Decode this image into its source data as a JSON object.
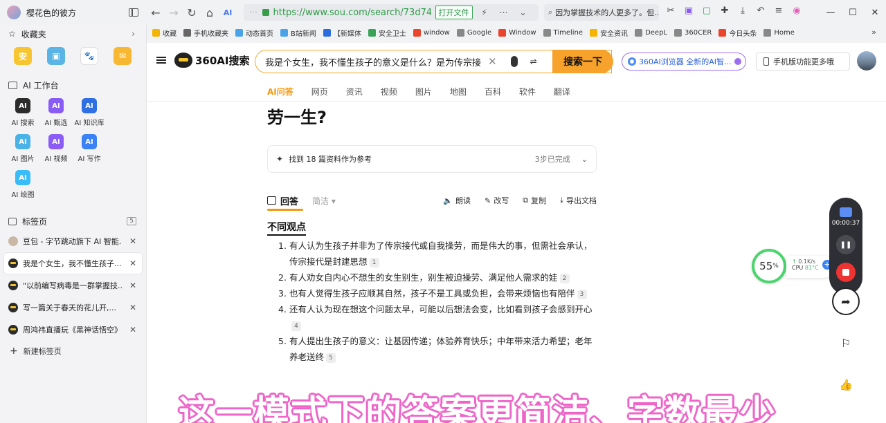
{
  "window": {
    "title": "樱花色的彼方"
  },
  "address_bar": {
    "url": "https://www.sou.com/search/73d74693c",
    "open_file_label": "打开文件"
  },
  "browser_search": {
    "query": "因为掌握技术的人更多了。但..."
  },
  "sidebar": {
    "favorites_label": "收藏夹",
    "fav_apps": [
      {
        "icon": "安",
        "color": "#f6c531"
      },
      {
        "icon": "bili-tv-icon",
        "color": "#5ab4e6"
      },
      {
        "icon": "paw-icon",
        "color": "#ffffff"
      },
      {
        "icon": "mail-icon",
        "color": "#f8b733"
      }
    ],
    "ai_workbench_label": "AI 工作台",
    "ai_tools": [
      {
        "label": "AI 搜索",
        "color": "#2b2b2b"
      },
      {
        "label": "AI 甄选",
        "color": "#8a5cf6"
      },
      {
        "label": "AI 知识库",
        "color": "#2f6fe4"
      },
      {
        "label": "AI 图片",
        "color": "#49b3e8"
      },
      {
        "label": "AI 视频",
        "color": "#8b5cf6"
      },
      {
        "label": "AI 写作",
        "color": "#3b82f6"
      },
      {
        "label": "AI 绘图",
        "color": "#38bdf8"
      }
    ],
    "tabs_label": "标签页",
    "tabs_count": "5",
    "tabs": [
      {
        "title": "豆包 - 字节跳动旗下 AI 智能..."
      },
      {
        "title": "我是个女生，我不懂生孩子..."
      },
      {
        "title": "\"以前编写病毒是一群掌握技..."
      },
      {
        "title": "写一篇关于春天的花儿开,..."
      },
      {
        "title": "周鸿祎直播玩《黑神话悟空》..."
      }
    ],
    "new_tab_label": "新建标签页"
  },
  "bookmarks": [
    {
      "label": "收藏",
      "color": "#f4b400"
    },
    {
      "label": "手机收藏夹",
      "color": "#666666"
    },
    {
      "label": "动态首页",
      "color": "#4aa3e8"
    },
    {
      "label": "B站新闻",
      "color": "#4aa3e8"
    },
    {
      "label": "【新媒体",
      "color": "#2b6de0"
    },
    {
      "label": "安全卫士",
      "color": "#3aa35a"
    },
    {
      "label": "window",
      "color": "#e8452c"
    },
    {
      "label": "Google",
      "color": "#888888"
    },
    {
      "label": "Window",
      "color": "#e8452c"
    },
    {
      "label": "Timeline",
      "color": "#888888"
    },
    {
      "label": "安全资讯",
      "color": "#f4b400"
    },
    {
      "label": "DeepL",
      "color": "#888888"
    },
    {
      "label": "360CER",
      "color": "#888888"
    },
    {
      "label": "今日头条",
      "color": "#e8452c"
    },
    {
      "label": "Home",
      "color": "#888888"
    }
  ],
  "page": {
    "logo_text": "360AI搜索",
    "query": "我是个女生，我不懂生孩子的意义是什么？是为传宗接代，还",
    "search_button": "搜索一下",
    "promo": "360AI浏览器 全新的AI智...",
    "mobile_link": "手机版功能更多哦",
    "categories": [
      "AI问答",
      "网页",
      "资讯",
      "视频",
      "图片",
      "地图",
      "百科",
      "软件",
      "翻译"
    ],
    "title_fragment": "劳一生?",
    "ref_text": "找到 18 篇资料作为参考",
    "ref_steps": "3步已完成",
    "answer_tab": "回答",
    "simple_tab": "简洁",
    "actions": [
      "朗读",
      "改写",
      "复制",
      "导出文档"
    ],
    "section_title": "不同观点",
    "views": [
      {
        "n": "1.",
        "text": "有人认为生孩子并非为了传宗接代或自我操劳，而是伟大的事，但需社会承认，传宗接代是封建思想",
        "cite": "1"
      },
      {
        "n": "2.",
        "text": "有人劝女自内心不想生的女生别生，别生被迫操劳、满足他人需求的娃",
        "cite": "2"
      },
      {
        "n": "3.",
        "text": "也有人觉得生孩子应顺其自然，孩子不是工具或负担，会带来烦恼也有陪伴",
        "cite": "3"
      },
      {
        "n": "4.",
        "text": "还有人认为现在想这个问题太早，可能以后想法会变，比如看到孩子会感到开心",
        "cite": "4"
      },
      {
        "n": "5.",
        "text": "有人提出生孩子的意义：让基因传递；体验养育快乐；中年带来活力希望；老年养老送终",
        "cite": "5"
      }
    ]
  },
  "recorder": {
    "time": "00:00:37"
  },
  "perf": {
    "percent": "55",
    "net": "0.1K/s",
    "cpu_label": "CPU",
    "cpu_temp": "81°C"
  },
  "caption": "这一模式下的答案更简洁、字数最少"
}
